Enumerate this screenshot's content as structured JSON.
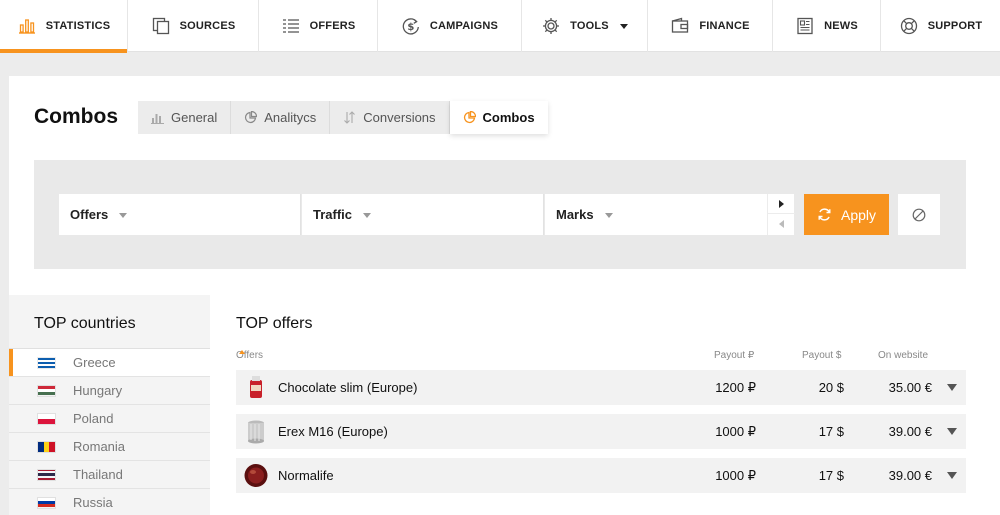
{
  "nav": {
    "items": [
      {
        "label": "STATISTICS",
        "icon": "bar-chart-icon",
        "active": true
      },
      {
        "label": "SOURCES",
        "icon": "copy-icon"
      },
      {
        "label": "OFFERS",
        "icon": "list-icon"
      },
      {
        "label": "CAMPAIGNS",
        "icon": "money-icon"
      },
      {
        "label": "TOOLS",
        "icon": "gear-icon"
      },
      {
        "label": "FINANCE",
        "icon": "wallet-icon"
      },
      {
        "label": "NEWS",
        "icon": "newspaper-icon"
      },
      {
        "label": "SUPPORT",
        "icon": "lifebuoy-icon"
      }
    ]
  },
  "page": {
    "title": "Combos"
  },
  "tabs": [
    {
      "label": "General",
      "icon": "bar-chart-icon"
    },
    {
      "label": "Analitycs",
      "icon": "pie-chart-icon"
    },
    {
      "label": "Conversions",
      "icon": "sort-icon"
    },
    {
      "label": "Combos",
      "icon": "pie-chart-icon",
      "active": true
    }
  ],
  "filters": {
    "offers": "Offers",
    "traffic": "Traffic",
    "marks": "Marks",
    "apply": "Apply"
  },
  "countries": {
    "title": "TOP countries",
    "items": [
      {
        "name": "Greece",
        "active": true
      },
      {
        "name": "Hungary"
      },
      {
        "name": "Poland"
      },
      {
        "name": "Romania"
      },
      {
        "name": "Thailand"
      },
      {
        "name": "Russia"
      }
    ]
  },
  "offers": {
    "title": "TOP offers",
    "columns": {
      "name": "Offers",
      "payout_rub": "Payout ₽",
      "payout_usd": "Payout $",
      "on_website": "On website"
    },
    "rows": [
      {
        "name": "Chocolate slim (Europe)",
        "payout_rub": "1200 ₽",
        "payout_usd": "20 $",
        "on_website": "35.00 €"
      },
      {
        "name": "Erex M16 (Europe)",
        "payout_rub": "1000 ₽",
        "payout_usd": "17 $",
        "on_website": "39.00 €"
      },
      {
        "name": "Normalife",
        "payout_rub": "1000 ₽",
        "payout_usd": "17 $",
        "on_website": "39.00 €"
      }
    ]
  },
  "colors": {
    "accent": "#f7931e",
    "panel": "#e9e9e9",
    "background": "#ececec"
  }
}
